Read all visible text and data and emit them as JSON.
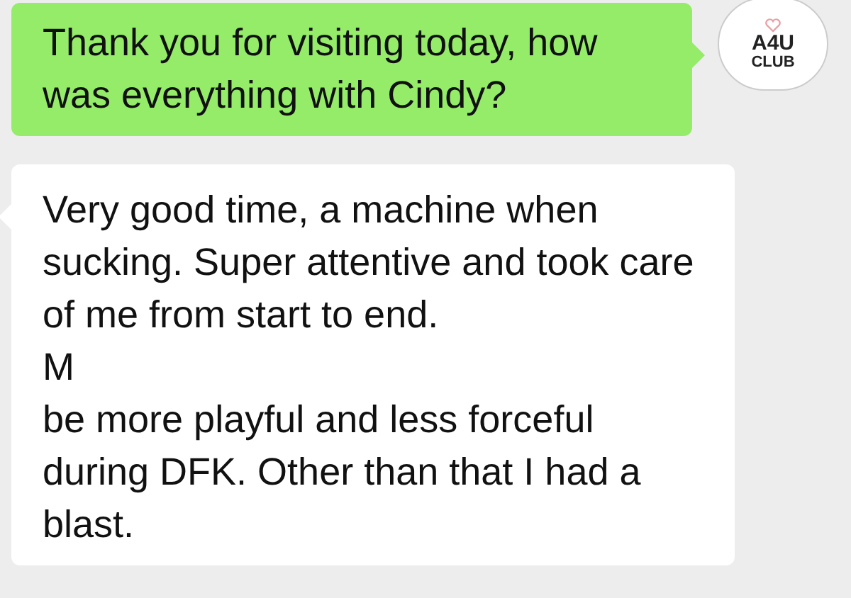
{
  "messages": [
    {
      "kind": "outgoing",
      "paragraphs": [
        "Thank you for visiting today, how was everything with Cindy?"
      ]
    },
    {
      "kind": "incoming",
      "paragraphs": [
        "Very good time, a machine when sucking. Super attentive and took care of me from start to end.",
        "M",
        "be more playful and less forceful during DFK. Other than that I had a blast."
      ]
    }
  ],
  "avatar": {
    "line_1": "A4U",
    "line_2": "CLUB"
  }
}
